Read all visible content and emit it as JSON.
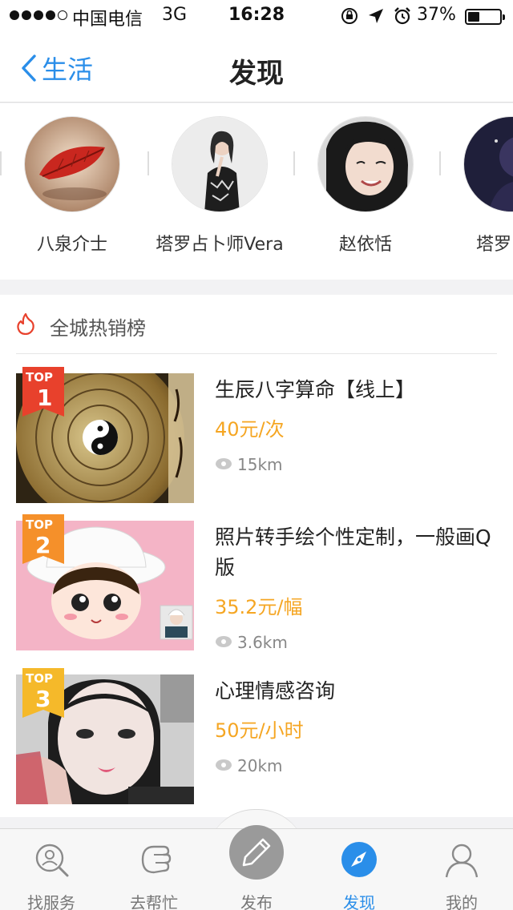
{
  "status_bar": {
    "carrier": "中国电信",
    "network": "3G",
    "time": "16:28",
    "battery_percent": "37%",
    "battery_level": 0.37
  },
  "nav": {
    "back_label": "生活",
    "title": "发现"
  },
  "people": [
    {
      "name": "八泉介士",
      "avatar": "red-leaf-avatar"
    },
    {
      "name": "塔罗占卜师Vera",
      "avatar": "woman-sketch-avatar"
    },
    {
      "name": "赵依恬",
      "avatar": "smiling-girl-avatar"
    },
    {
      "name": "塔罗师明",
      "avatar": "dark-avatar"
    }
  ],
  "hot_list": {
    "title": "全城热销榜",
    "badge_text": "TOP",
    "items": [
      {
        "rank": "1",
        "title": "生辰八字算命【线上】",
        "price": "40元/次",
        "distance": "15km",
        "badge_color": "#e8412c"
      },
      {
        "rank": "2",
        "title": "照片转手绘个性定制，一般画Q版",
        "price": "35.2元/幅",
        "distance": "3.6km",
        "badge_color": "#f5902a"
      },
      {
        "rank": "3",
        "title": "心理情感咨询",
        "price": "50元/小时",
        "distance": "20km",
        "badge_color": "#f5b92a"
      }
    ]
  },
  "tabbar": {
    "tabs": [
      {
        "label": "找服务",
        "icon": "search-service-icon"
      },
      {
        "label": "去帮忙",
        "icon": "helping-hand-icon"
      },
      {
        "label": "发布",
        "icon": "pencil-icon"
      },
      {
        "label": "发现",
        "icon": "compass-icon",
        "active": true
      },
      {
        "label": "我的",
        "icon": "user-icon"
      }
    ]
  },
  "colors": {
    "accent": "#2a8ee9",
    "price": "#f5a623"
  }
}
